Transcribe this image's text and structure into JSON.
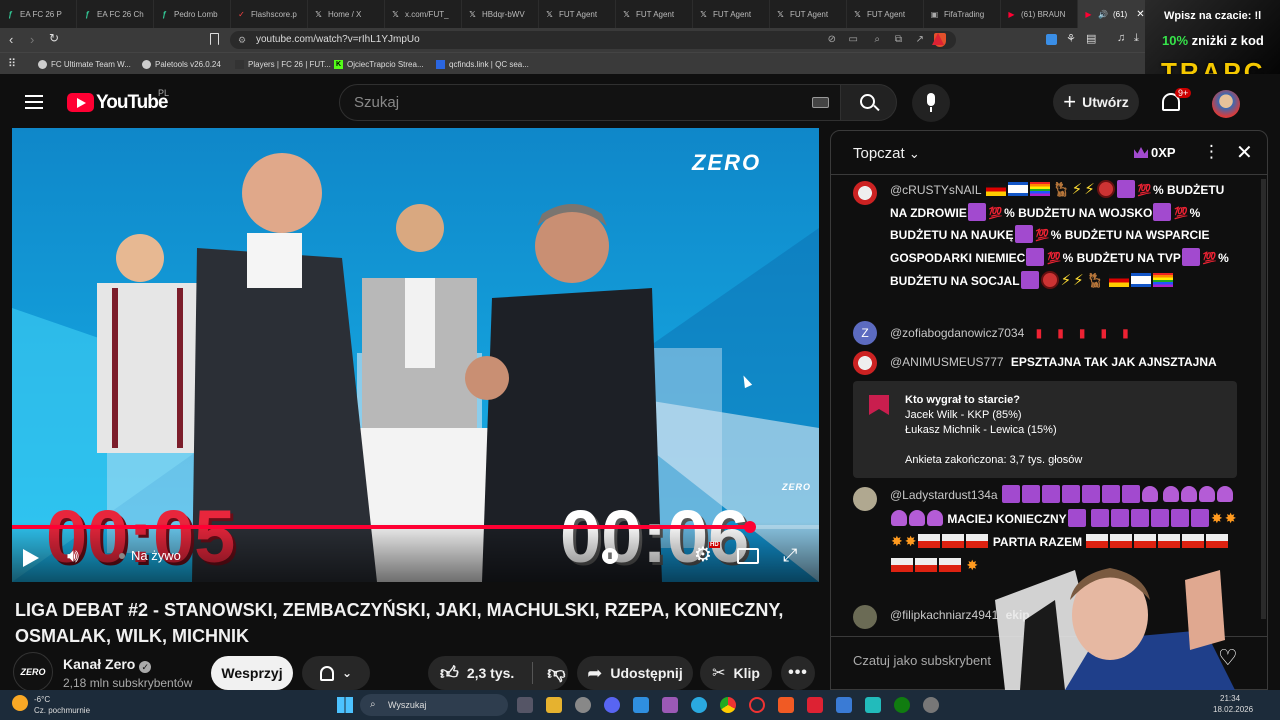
{
  "browser": {
    "tabs": [
      {
        "label": "EA FC 26 P",
        "icon": "fc-icon"
      },
      {
        "label": "EA FC 26 Ch",
        "icon": "fc-icon"
      },
      {
        "label": "Pedro Lomb",
        "icon": "fc-icon"
      },
      {
        "label": "Flashscore.p",
        "icon": "flashscore-icon"
      },
      {
        "label": "Home / X",
        "icon": "x-icon"
      },
      {
        "label": "x.com/FUT_",
        "icon": "x-icon"
      },
      {
        "label": "HBdqr-bWV",
        "icon": "x-icon"
      },
      {
        "label": "FUT Agent",
        "icon": "x-icon"
      },
      {
        "label": "FUT Agent",
        "icon": "x-icon"
      },
      {
        "label": "FUT Agent",
        "icon": "x-icon"
      },
      {
        "label": "FUT Agent",
        "icon": "x-icon"
      },
      {
        "label": "FUT Agent",
        "icon": "x-icon"
      },
      {
        "label": "FifaTrading",
        "icon": "fifa-icon"
      },
      {
        "label": "(61) BRAUN",
        "icon": "youtube-icon"
      },
      {
        "label": "(61)",
        "icon": "youtube-icon"
      }
    ],
    "url": "youtube.com/watch?v=rIhL1YJmpUo",
    "bookmarks": [
      "FC Ultimate Team W...",
      "Paletools v26.0.24",
      "Players | FC 26 | FUT...",
      "OjciecTrapcio Strea...",
      "qcfinds.link | QC sea..."
    ]
  },
  "promo": {
    "line1": "Wpisz na czacie: !l",
    "line2_pct": "10%",
    "line2_rest": " zniżki z kod",
    "line3": "TRAPC"
  },
  "youtube": {
    "logo": "YouTube",
    "region": "PL",
    "search_placeholder": "Szukaj",
    "create_label": "Utwórz",
    "notif_count": "9+"
  },
  "video": {
    "brand": "ZERO",
    "timer_left": "00:05",
    "timer_right": "00:06",
    "live_label": "Na żywo",
    "small_brand": "ZERO",
    "progress": 0.915
  },
  "title": {
    "line1": "LIGA DEBAT #2 - STANOWSKI, ZEMBACZYŃSKI, JAKI, MACHULSKI, RZEPA, KONIECZNY,",
    "line2": "OSMALAK, WILK, MICHNIK"
  },
  "channel": {
    "name": "Kanał Zero",
    "subs": "2,18 mln subskrybentów",
    "logo": "ZERO",
    "support": "Wesprzyj",
    "likes": "2,3 tys.",
    "share": "Udostępnij",
    "clip": "Klip"
  },
  "chat": {
    "header": "Topczat",
    "points": "0XP",
    "messages": [
      {
        "author": "@cRUSTYsNAIL",
        "t1": "% BUDŻETU NA ZDROWIE",
        "t2": "% BUDŻETU NA WOJSKO",
        "t3": "% BUDŻETU NA NAUKĘ",
        "t4": "% BUDŻETU NA",
        "t5": "WSPARCIE GOSPODARKI NIEMIEC",
        "t6": "% BUDŻETU NA",
        "t7": "TVP",
        "t8": "% BUDŻETU NA SOCJAL"
      },
      {
        "author": "@zofiabogdanowicz7034",
        "avatar_letter": "Z"
      },
      {
        "author": "@ANIMUSMEUS777",
        "text": "EPSZTAJNA TAK JAK AJNSZTAJNA"
      },
      {
        "author": "@Ladystardust134a",
        "t1": "MACIEJ KONIECZNY",
        "t2": "PARTIA RAZEM"
      },
      {
        "author": "@filipkachniarz4941",
        "text": "ekip"
      }
    ],
    "poll": {
      "question": "Kto wygrał to starcie?",
      "opt1": "Jacek Wilk - KKP (85%)",
      "opt2": "Łukasz Michnik - Lewica (15%)",
      "footer": "Ankieta zakończona: 3,7 tys. głosów"
    },
    "input_placeholder": "Czatuj jako subskrybent"
  },
  "taskbar": {
    "weather_temp": "-6°C",
    "weather_desc": "Cz. pochmurnie",
    "search": "Wyszukaj",
    "time": "21:34",
    "date": "18.02.2026"
  },
  "colors": {
    "yt_red": "#ff0033",
    "chat_purple": "#a24acf",
    "video_blue": "#1aa8e0"
  }
}
